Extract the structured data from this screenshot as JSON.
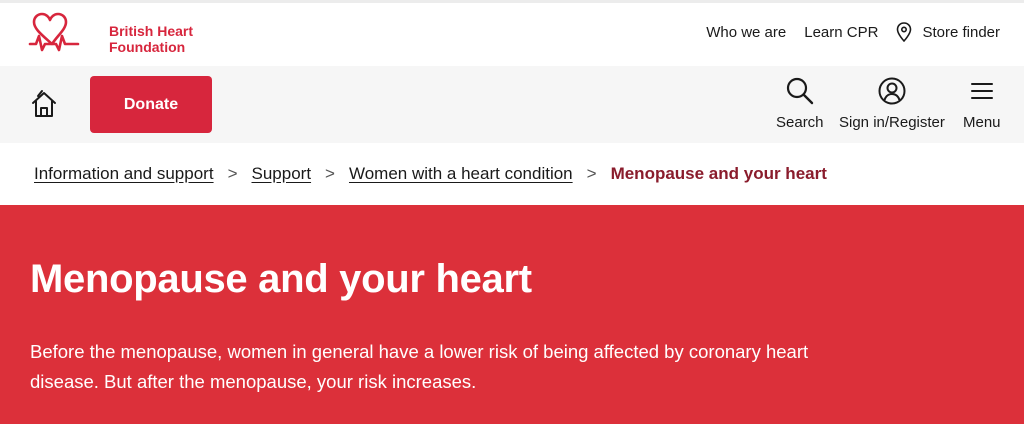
{
  "brand": {
    "line1": "British Heart",
    "line2": "Foundation",
    "color": "#d7263d"
  },
  "utility_nav": {
    "who_we_are": "Who we are",
    "learn_cpr": "Learn CPR",
    "store_finder": "Store finder"
  },
  "main_nav": {
    "donate": "Donate",
    "search": "Search",
    "sign_in": "Sign in/Register",
    "menu": "Menu"
  },
  "breadcrumb": {
    "items": [
      "Information and support",
      "Support",
      "Women with a heart condition"
    ],
    "current": "Menopause and your heart",
    "separator": ">"
  },
  "hero": {
    "title": "Menopause and your heart",
    "intro": "Before the menopause, women in general have a lower risk of being affected by coronary heart disease. But after the menopause, your risk increases.",
    "background": "#dc303a"
  }
}
